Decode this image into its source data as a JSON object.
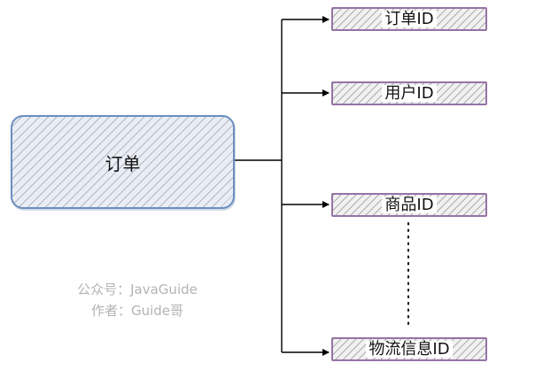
{
  "diagram": {
    "root": {
      "label": "订单"
    },
    "children": [
      {
        "label": "订单ID"
      },
      {
        "label": "用户ID"
      },
      {
        "label": "商品ID"
      },
      {
        "label": "物流信息ID"
      }
    ]
  },
  "watermark": {
    "line1": "公众号：JavaGuide",
    "line2": "作者：Guide哥"
  },
  "colors": {
    "root_border": "#6c8ebf",
    "child_border": "#9673a6",
    "connector": "#000000",
    "watermark_text": "#b3b3b3"
  }
}
